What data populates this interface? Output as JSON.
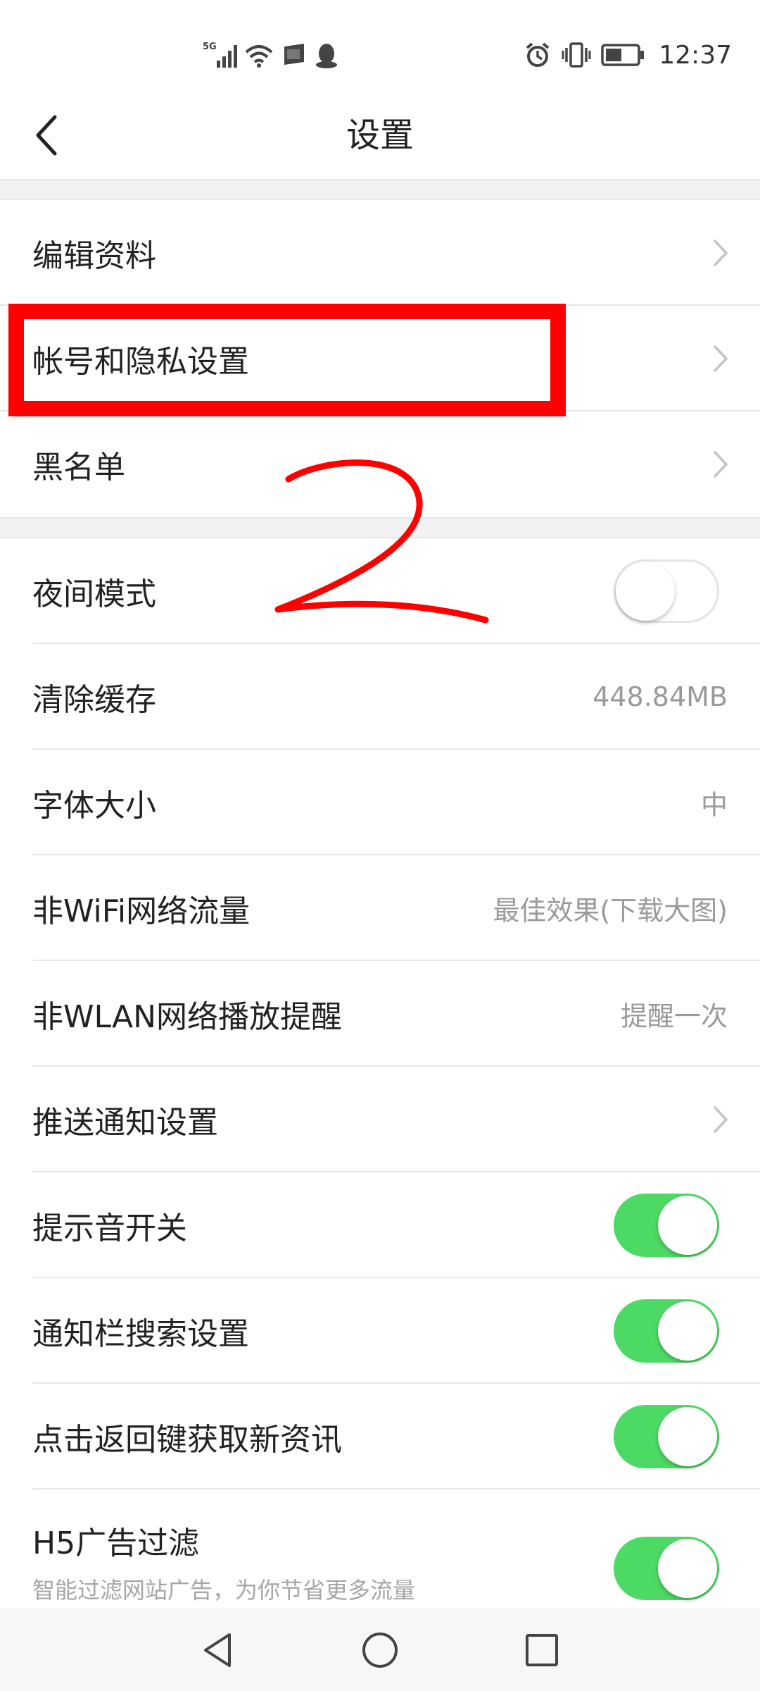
{
  "status_bar": {
    "network": "5G",
    "time": "12:37"
  },
  "header": {
    "title": "设置"
  },
  "section1": [
    {
      "label": "编辑资料"
    },
    {
      "label": "帐号和隐私设置"
    },
    {
      "label": "黑名单"
    }
  ],
  "section2": [
    {
      "label": "夜间模式",
      "toggle": false
    },
    {
      "label": "清除缓存",
      "value": "448.84MB"
    },
    {
      "label": "字体大小",
      "value": "中"
    },
    {
      "label": "非WiFi网络流量",
      "value": "最佳效果(下载大图)"
    },
    {
      "label": "非WLAN网络播放提醒",
      "value": "提醒一次"
    },
    {
      "label": "推送通知设置"
    },
    {
      "label": "提示音开关",
      "toggle": true
    },
    {
      "label": "通知栏搜索设置",
      "toggle": true
    },
    {
      "label": "点击返回键获取新资讯",
      "toggle": true
    },
    {
      "label": "H5广告过滤",
      "sublabel": "智能过滤网站广告，为你节省更多流量",
      "toggle": true
    }
  ],
  "annotation": {
    "number": "2"
  },
  "colors": {
    "toggle_on": "#4cd964",
    "annotation": "#ff0000"
  }
}
